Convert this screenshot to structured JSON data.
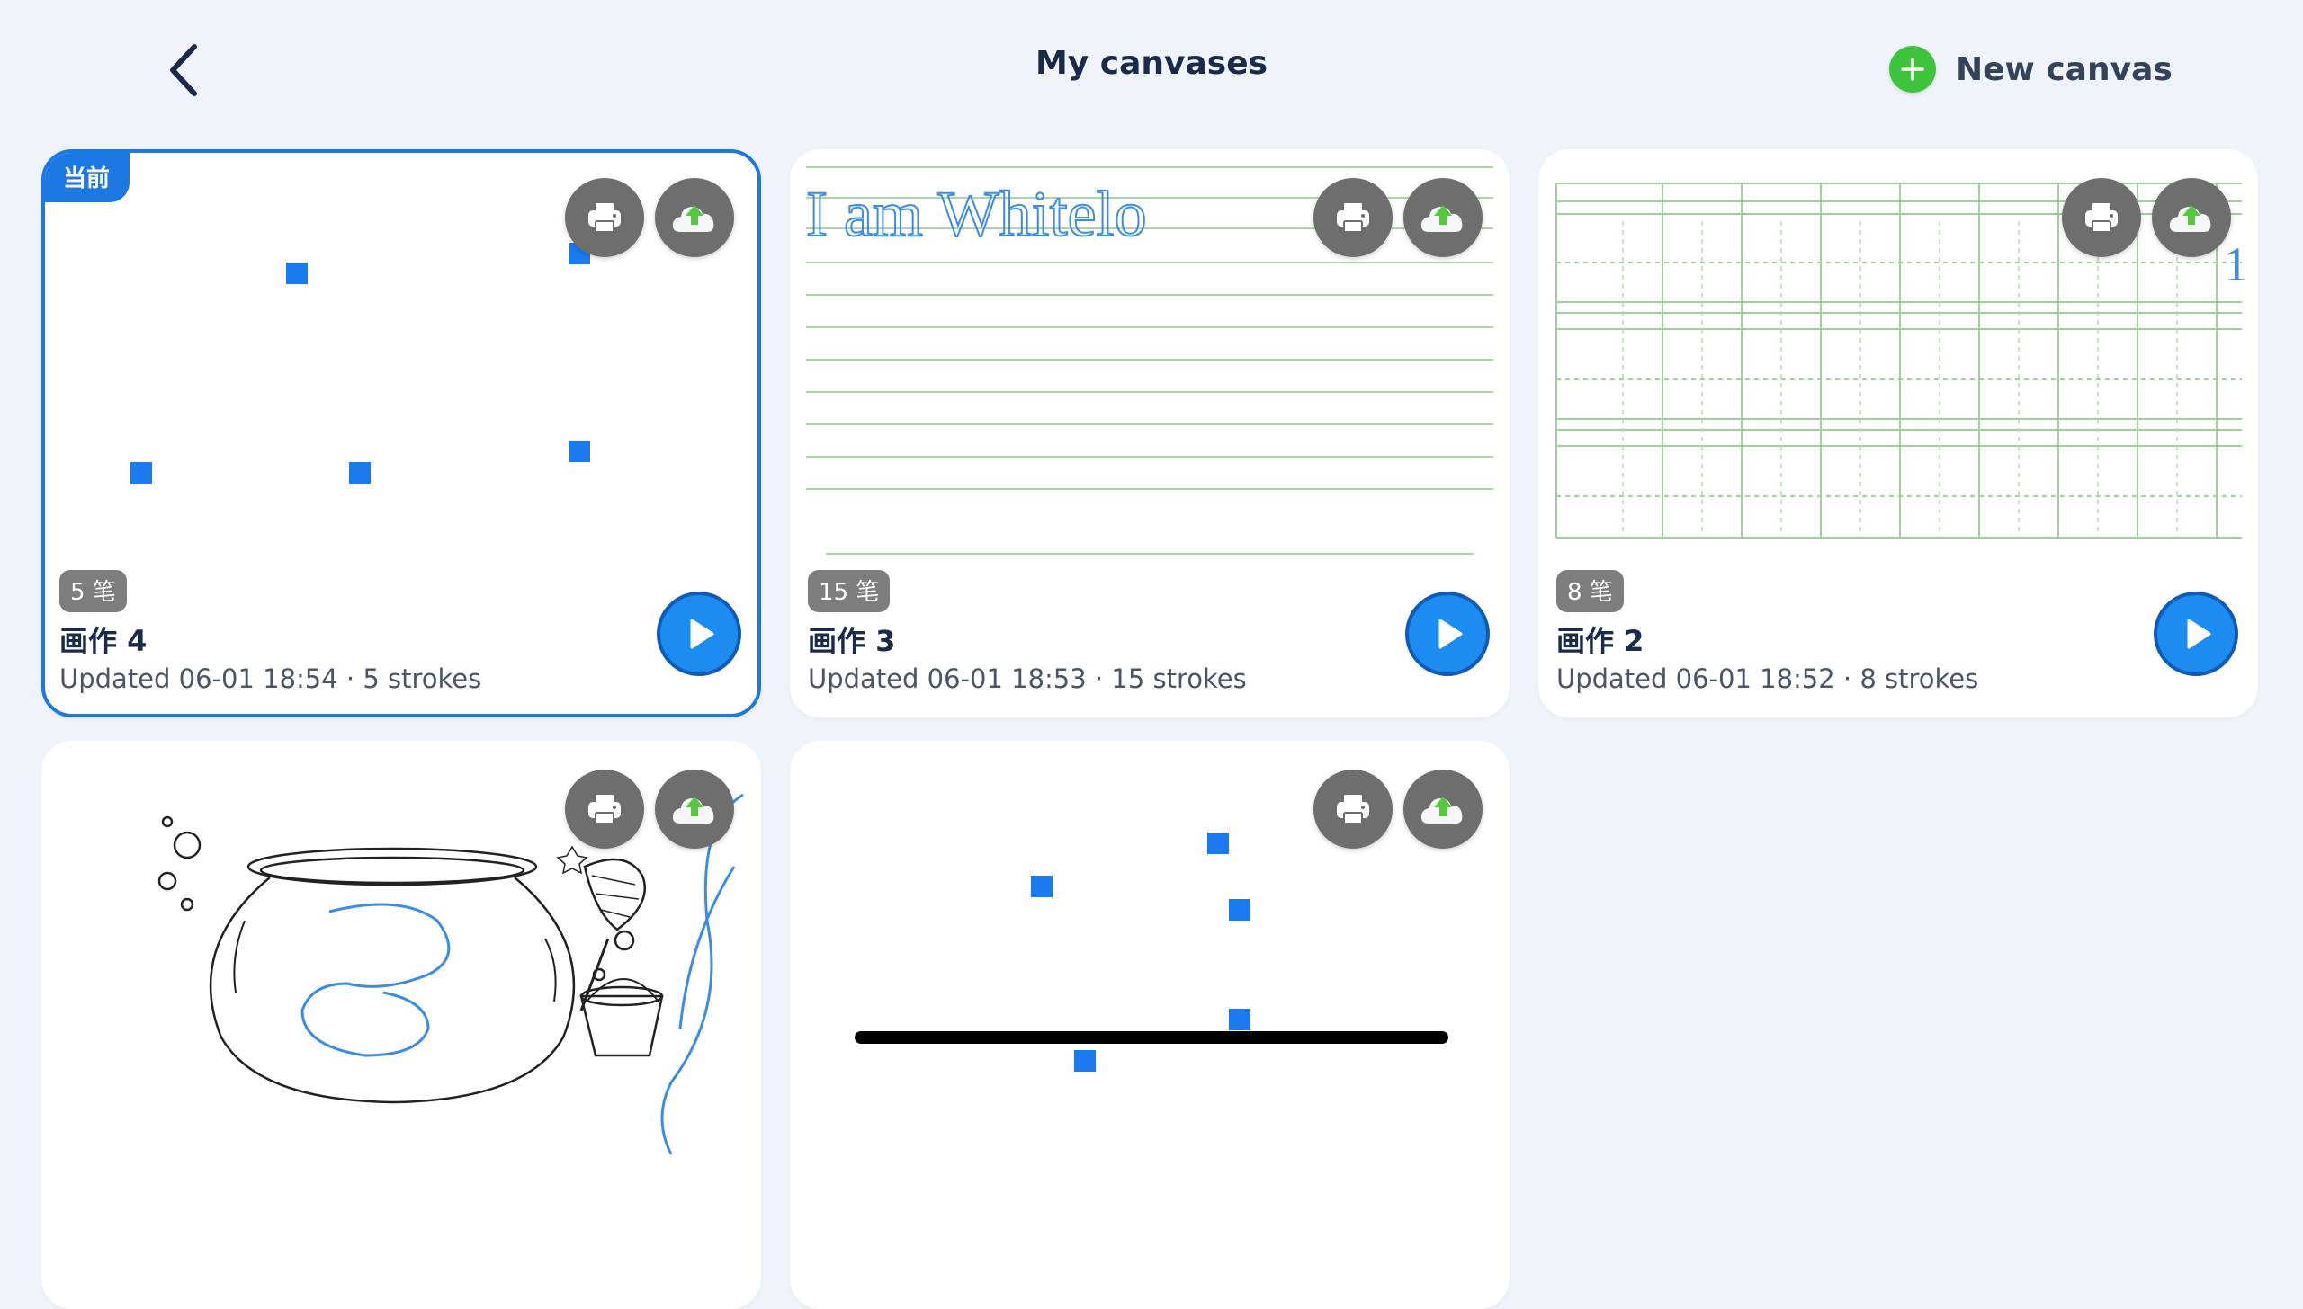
{
  "header": {
    "title": "My canvases",
    "new_canvas_label": "New canvas"
  },
  "current_tag": "当前",
  "canvases": [
    {
      "name": "画作 4",
      "badge": "5 笔",
      "meta": "Updated 06-01 18:54 · 5 strokes",
      "current": true
    },
    {
      "name": "画作 3",
      "badge": "15 笔",
      "meta": "Updated 06-01 18:53 · 15 strokes",
      "current": false,
      "handwriting": "I am Whitelo"
    },
    {
      "name": "画作 2",
      "badge": "8 笔",
      "meta": "Updated 06-01 18:52 · 8 strokes",
      "current": false,
      "handwriting": "1"
    },
    {
      "name": "",
      "badge": "",
      "meta": "",
      "current": false
    },
    {
      "name": "",
      "badge": "",
      "meta": "",
      "current": false
    }
  ],
  "icons": {
    "back": "chevron-left-icon",
    "new": "plus-circle-icon",
    "print": "printer-icon",
    "upload": "cloud-upload-icon",
    "play": "play-icon"
  },
  "colors": {
    "accent": "#1c78e2",
    "green": "#3ec43b",
    "dot": "#1a7bf0"
  }
}
